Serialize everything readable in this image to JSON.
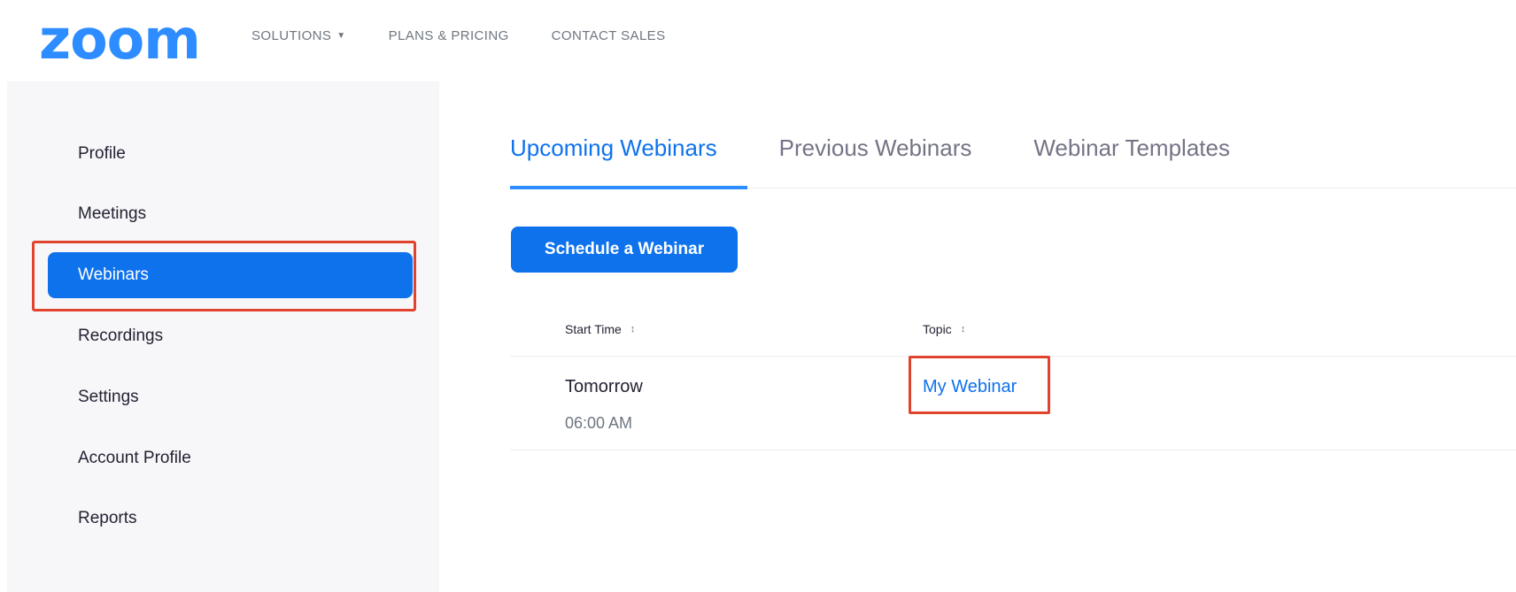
{
  "brand": {
    "logo_text": "zoom",
    "color": "#2d8cff"
  },
  "topnav": {
    "items": [
      {
        "label": "SOLUTIONS",
        "has_dropdown": true
      },
      {
        "label": "PLANS & PRICING"
      },
      {
        "label": "CONTACT SALES"
      }
    ],
    "dropdown_icon": "chevron-down-icon"
  },
  "sidebar": {
    "items": [
      {
        "label": "Profile"
      },
      {
        "label": "Meetings"
      },
      {
        "label": "Webinars",
        "active": true
      },
      {
        "label": "Recordings"
      },
      {
        "label": "Settings"
      },
      {
        "label": "Account Profile"
      },
      {
        "label": "Reports"
      }
    ],
    "active_color": "#0e72ed"
  },
  "tabs": [
    {
      "label": "Upcoming Webinars",
      "active": true
    },
    {
      "label": "Previous Webinars"
    },
    {
      "label": "Webinar Templates"
    }
  ],
  "actions": {
    "schedule_label": "Schedule a Webinar"
  },
  "table": {
    "columns": [
      {
        "label": "Start Time",
        "sort_icon": "sort-icon"
      },
      {
        "label": "Topic",
        "sort_icon": "sort-icon"
      }
    ],
    "rows": [
      {
        "start_day": "Tomorrow",
        "start_time": "06:00 AM",
        "topic": "My Webinar"
      }
    ]
  },
  "annotation_color": "#e0442e"
}
